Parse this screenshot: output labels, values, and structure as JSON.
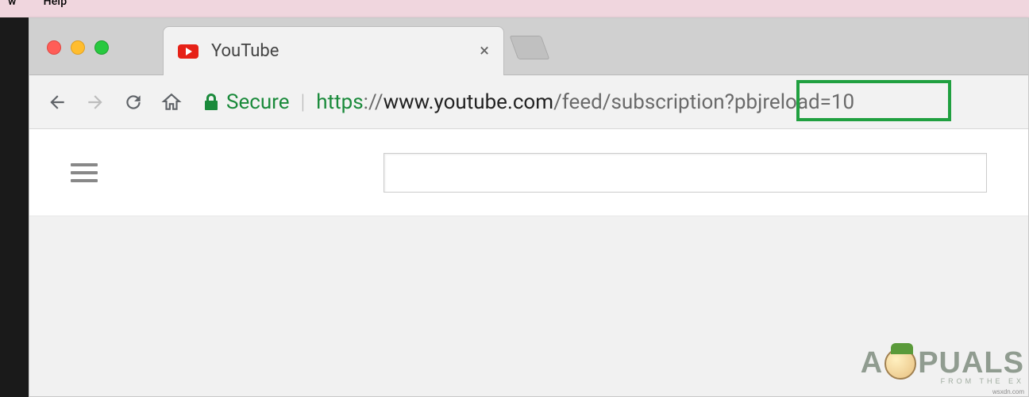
{
  "menubar": {
    "item1": "w",
    "item2": "Help"
  },
  "tab": {
    "title": "YouTube"
  },
  "addressbar": {
    "secure_label": "Secure",
    "url_scheme": "https",
    "url_separator": "://",
    "url_host": "www.youtube.com",
    "url_path": "/feed/subscription",
    "url_query": "?pbjreload=10"
  },
  "watermark": {
    "brand_pre": "A",
    "brand_post": "PUALS",
    "subtitle": "FROM THE EX",
    "domain": "wsxdn.com"
  }
}
